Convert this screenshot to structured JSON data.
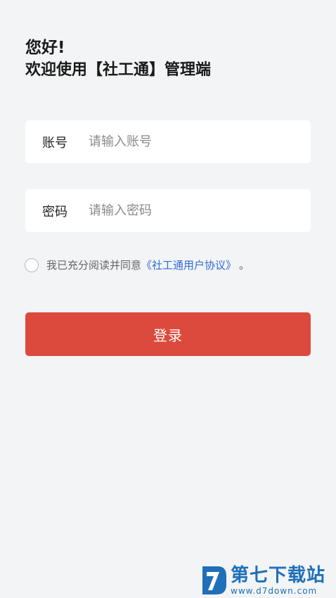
{
  "greeting": {
    "line1": "您好!",
    "line2": "欢迎使用【社工通】管理端"
  },
  "form": {
    "account": {
      "label": "账号",
      "placeholder": "请输入账号",
      "value": ""
    },
    "password": {
      "label": "密码",
      "placeholder": "请输入密码",
      "value": ""
    }
  },
  "agreement": {
    "checked": false,
    "text": "我已充分阅读并同意",
    "link": "《社工通用户协议》",
    "suffix": "。"
  },
  "login_button": "登录",
  "watermark": {
    "title": "第七下载站",
    "url": "www.d7down.com"
  },
  "colors": {
    "background": "#f3f4f6",
    "primary": "#dc4a3d",
    "link": "#2e6bd6",
    "watermark": "#1f6fb9"
  }
}
